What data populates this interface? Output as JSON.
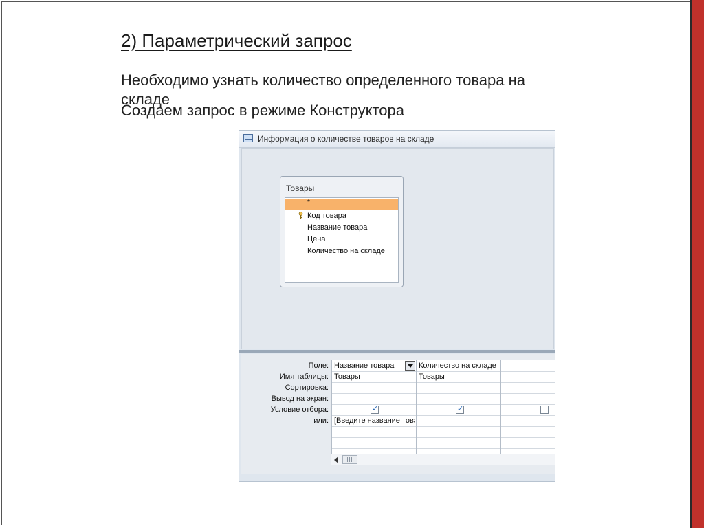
{
  "slide": {
    "title": "2) Параметрический запрос",
    "line1": "Необходимо узнать количество определенного товара на",
    "line1b": "складе",
    "line2": "Создаем запрос в режиме Конструктора"
  },
  "window": {
    "title": "Информация о количестве товаров на складе"
  },
  "table": {
    "name": "Товары",
    "fields": [
      {
        "label": "*",
        "selected": true,
        "key": false
      },
      {
        "label": "Код товара",
        "selected": false,
        "key": true
      },
      {
        "label": "Название товара",
        "selected": false,
        "key": false
      },
      {
        "label": "Цена",
        "selected": false,
        "key": false
      },
      {
        "label": "Количество на складе",
        "selected": false,
        "key": false
      }
    ]
  },
  "grid": {
    "row_labels": [
      "Поле:",
      "Имя таблицы:",
      "Сортировка:",
      "Вывод на экран:",
      "Условие отбора:",
      "или:"
    ],
    "columns": [
      {
        "field": "Название товара",
        "table": "Товары",
        "show": true,
        "criteria": "[Введите название товара]"
      },
      {
        "field": "Количество на складе",
        "table": "Товары",
        "show": true,
        "criteria": ""
      },
      {
        "field": "",
        "table": "",
        "show": false,
        "criteria": ""
      }
    ]
  },
  "colors": {
    "accent_bar": "#c0312b",
    "selected_field": "#f8b26a"
  }
}
